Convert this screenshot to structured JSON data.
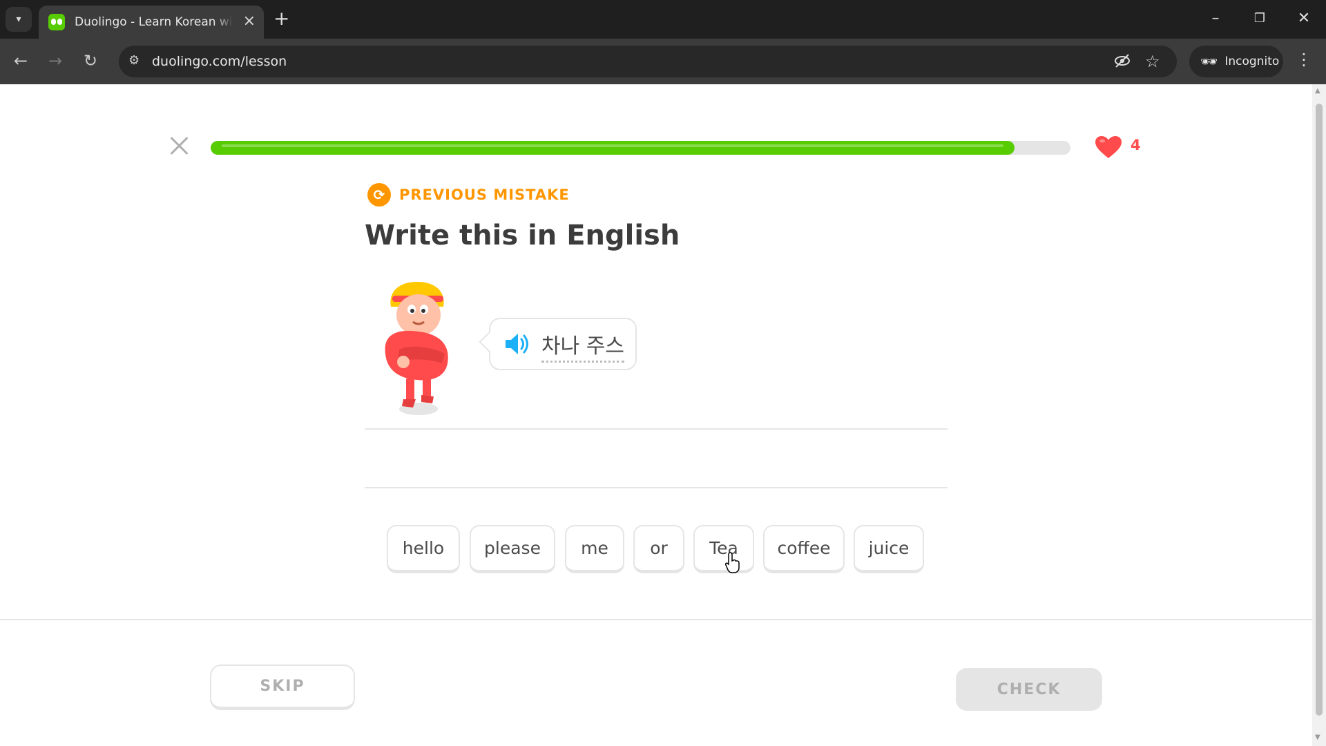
{
  "browser": {
    "tab_title": "Duolingo - Learn Korean with lessons",
    "url": "duolingo.com/lesson",
    "incognito_label": "Incognito",
    "icons": [
      "tab-search-icon",
      "duolingo-favicon",
      "close-tab-icon",
      "new-tab-icon",
      "minimize-icon",
      "restore-icon",
      "close-window-icon",
      "back-icon",
      "forward-icon",
      "reload-icon",
      "site-info-icon",
      "eye-off-icon",
      "bookmark-star-icon",
      "incognito-icon",
      "menu-icon"
    ]
  },
  "lesson": {
    "progress_percent": 93.5,
    "hearts": "4",
    "tag_label": "PREVIOUS MISTAKE",
    "title": "Write this in English",
    "korean_prompt": "차나 주스",
    "word_bank": [
      "hello",
      "please",
      "me",
      "or",
      "Tea",
      "coffee",
      "juice"
    ],
    "skip_label": "SKIP",
    "check_label": "CHECK"
  },
  "colors": {
    "brand_green": "#58cc02",
    "heart_red": "#ff4b4b",
    "mistake_orange": "#ff9600",
    "speaker_blue": "#1cb0f6"
  }
}
